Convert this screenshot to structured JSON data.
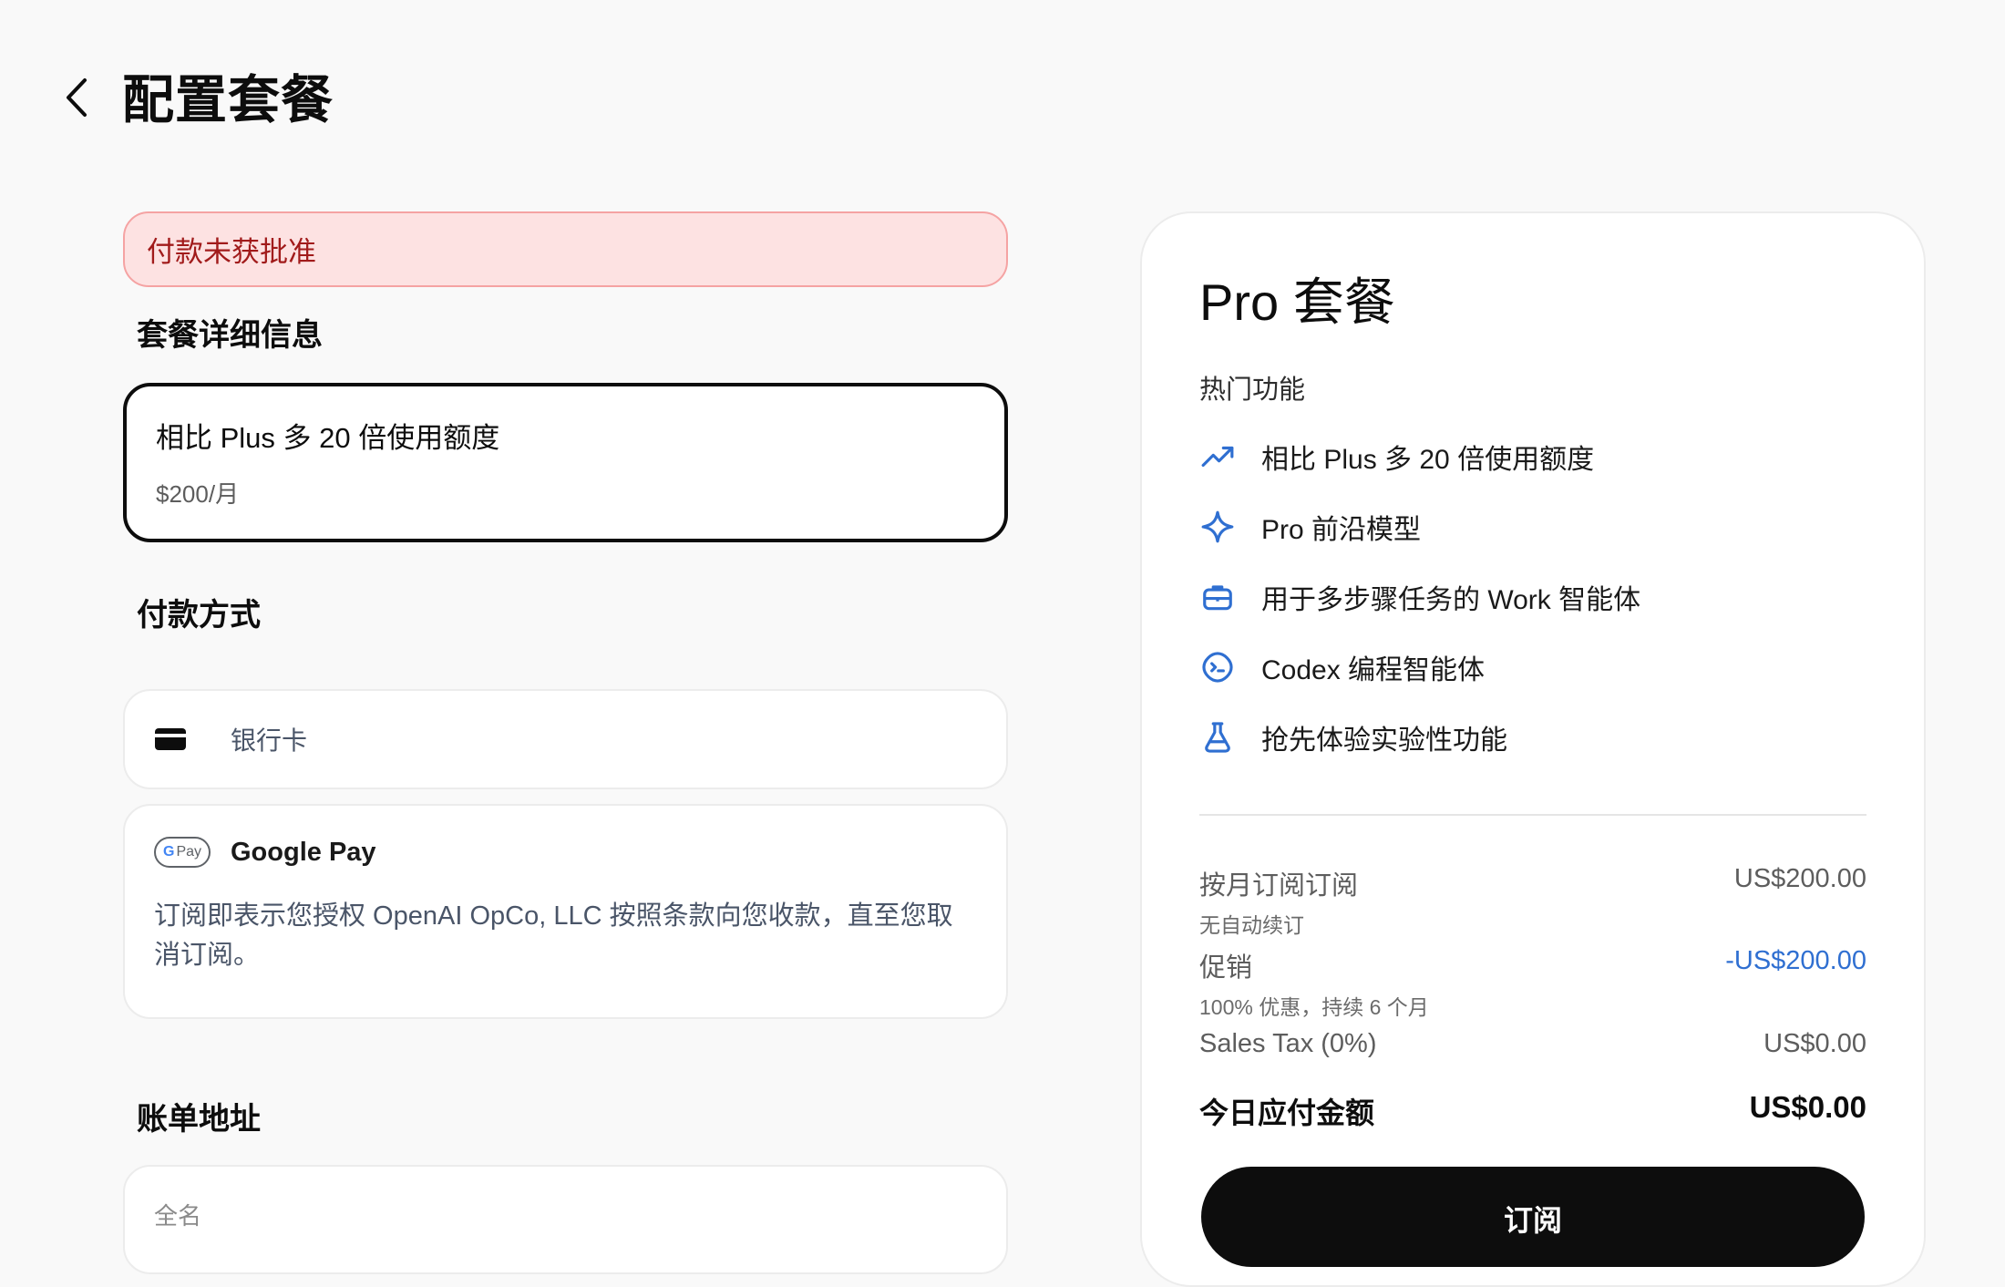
{
  "header": {
    "title": "配置套餐"
  },
  "error_banner": {
    "text": "付款未获批准"
  },
  "plan_details": {
    "section_title": "套餐详细信息",
    "option": {
      "name": "相比 Plus 多 20 倍使用额度",
      "price": "$200/月"
    }
  },
  "payment": {
    "section_title": "付款方式",
    "card": {
      "label": "银行卡",
      "icon": "credit-card-icon"
    },
    "google_pay": {
      "badge": "G Pay",
      "label": "Google Pay",
      "note": "订阅即表示您授权 OpenAI OpCo, LLC 按照条款向您收款，直至您取消订阅。"
    }
  },
  "billing": {
    "section_title": "账单地址",
    "full_name_label": "全名"
  },
  "summary": {
    "plan_title": "Pro 套餐",
    "features_title": "热门功能",
    "features": [
      {
        "icon": "trending-up-icon",
        "text": "相比 Plus 多 20 倍使用额度"
      },
      {
        "icon": "sparkle-icon",
        "text": "Pro 前沿模型"
      },
      {
        "icon": "briefcase-icon",
        "text": "用于多步骤任务的 Work 智能体"
      },
      {
        "icon": "codex-icon",
        "text": "Codex 编程智能体"
      },
      {
        "icon": "flask-icon",
        "text": "抢先体验实验性功能"
      }
    ],
    "lines": [
      {
        "label": "按月订阅订阅",
        "sub": "无自动续订",
        "amount": "US$200.00"
      },
      {
        "label": "促销",
        "sub": "100% 优惠，持续 6 个月",
        "amount": "-US$200.00"
      },
      {
        "label": "Sales Tax (0%)",
        "amount": "US$0.00"
      }
    ],
    "total": {
      "label": "今日应付金额",
      "amount": "US$0.00"
    },
    "subscribe_label": "订阅"
  },
  "colors": {
    "accent_blue": "#2f6fd1",
    "error_bg": "#fde2e2",
    "error_text": "#a11b1b",
    "button_bg": "#0d0d0d"
  }
}
